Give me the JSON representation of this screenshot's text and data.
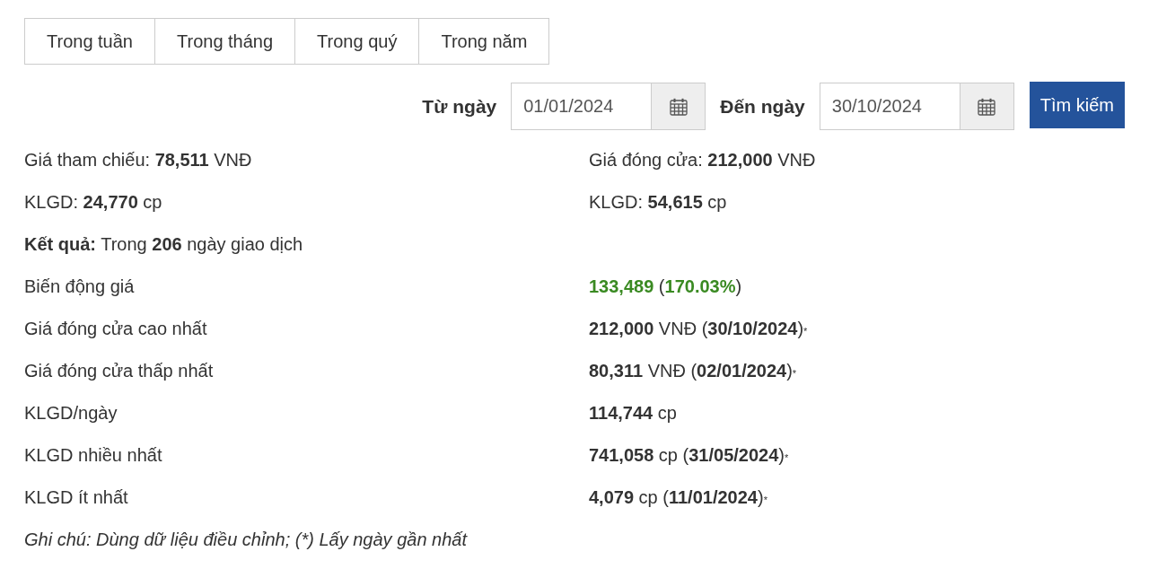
{
  "period_tabs": [
    {
      "label": "Trong tuần",
      "selected": false
    },
    {
      "label": "Trong tháng",
      "selected": false
    },
    {
      "label": "Trong quý",
      "selected": false
    },
    {
      "label": "Trong năm",
      "selected": false
    }
  ],
  "date_filter": {
    "from_label": "Từ ngày",
    "from_value": "01/01/2024",
    "to_label": "Đến ngày",
    "to_value": "30/10/2024",
    "search_button": "Tìm kiếm"
  },
  "summary": [
    {
      "left": "Giá tham chiếu: **78,511** VNĐ",
      "right": "Giá đóng cửa: **212,000** VNĐ"
    },
    {
      "left": "KLGD: **24,770** cp",
      "right": "KLGD: **54,615** cp"
    }
  ],
  "result": "**Kết quả:** Trong **206** ngày giao dịch",
  "stats": [
    {
      "label": "Biến động giá",
      "value": "**133,489** (**170.03%**)",
      "positive": true
    },
    {
      "label": "Giá đóng cửa cao nhất",
      "value": "**212,000** VNĐ (**30/10/2024**)",
      "mark": "*"
    },
    {
      "label": "Giá đóng cửa thấp nhất",
      "value": "**80,311** VNĐ (**02/01/2024**)",
      "mark": "*"
    },
    {
      "label": "KLGD/ngày",
      "value": "**114,744** cp"
    },
    {
      "label": "KLGD nhiều nhất",
      "value": "**741,058** cp (**31/05/2024**)",
      "mark": "*"
    },
    {
      "label": "KLGD ít nhất",
      "value": "**4,079** cp (**11/01/2024**)",
      "mark": "*"
    }
  ],
  "note": "Ghi chú: Dùng dữ liệu điều chỉnh; (*) Lấy ngày gần nhất"
}
